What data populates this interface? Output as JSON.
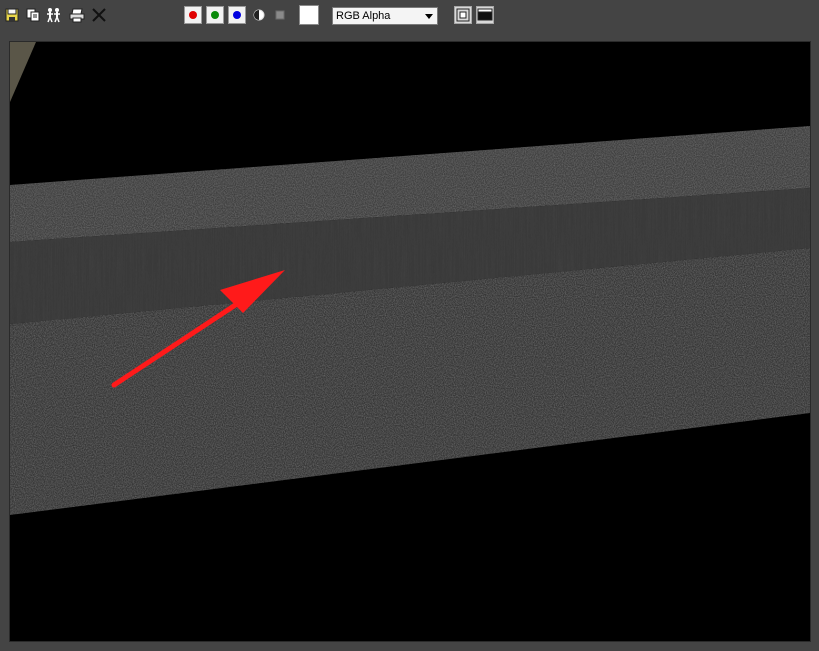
{
  "toolbar": {
    "icons": [
      "save-icon",
      "copy-icon",
      "clone-window-icon",
      "print-icon",
      "clear-icon"
    ],
    "channels": [
      {
        "name": "red-channel",
        "color": "#e00000"
      },
      {
        "name": "green-channel",
        "color": "#0a8a0a"
      },
      {
        "name": "blue-channel",
        "color": "#0000e0"
      }
    ],
    "swatch_color": "#ffffff",
    "channel_display": {
      "selected": "RGB Alpha"
    }
  },
  "viewport": {
    "background": "#000000",
    "annotation_arrow_color": "#ff1a1a"
  }
}
